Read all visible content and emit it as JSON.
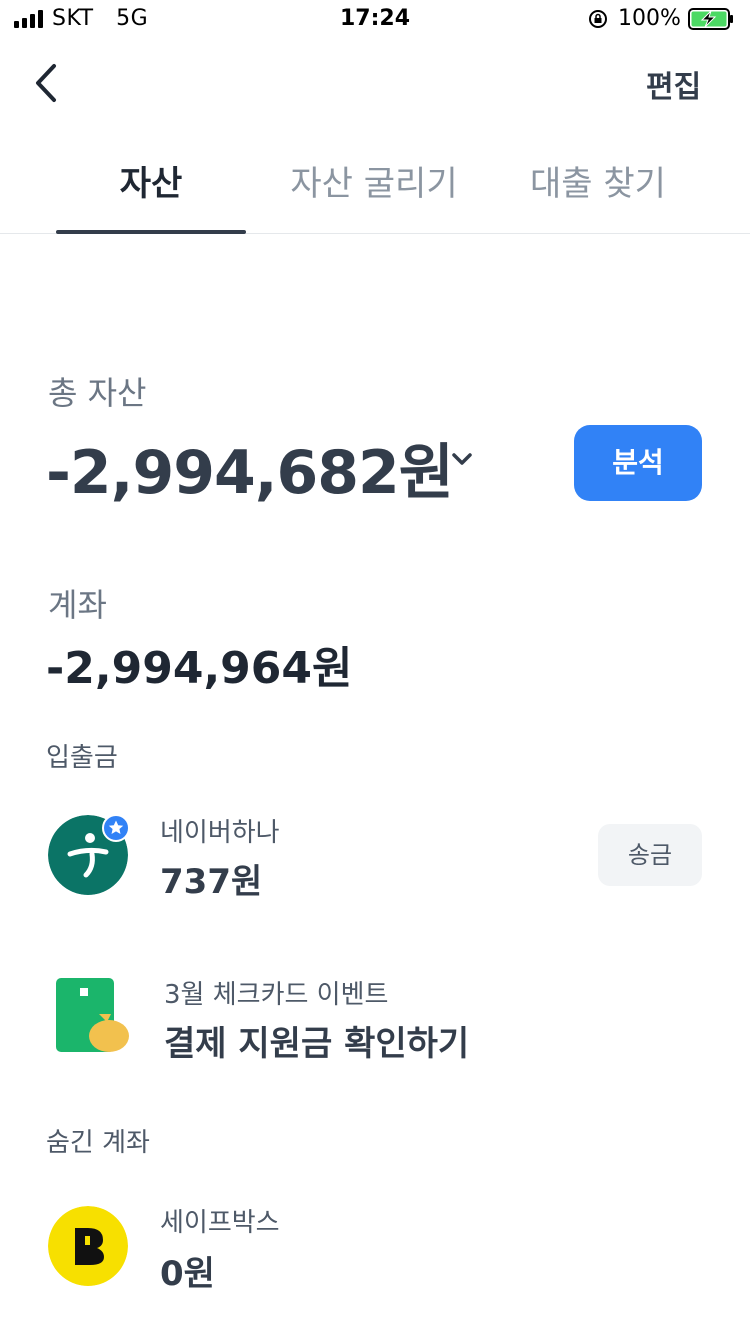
{
  "status_bar": {
    "carrier": "SKT",
    "network": "5G",
    "time": "17:24",
    "battery": "100%"
  },
  "header": {
    "edit_label": "편집"
  },
  "tabs": [
    {
      "label": "자산"
    },
    {
      "label": "자산 굴리기"
    },
    {
      "label": "대출 찾기"
    }
  ],
  "total": {
    "label": "총 자산",
    "amount": "-2,994,682원",
    "analysis_label": "분석"
  },
  "accounts": {
    "label": "계좌",
    "amount": "-2,994,964원"
  },
  "deposit_section": {
    "title": "입출금",
    "items": [
      {
        "name": "네이버하나",
        "amount": "737원",
        "action": "송금"
      }
    ]
  },
  "promo": {
    "subtitle": "3월 체크카드 이벤트",
    "title": "결제 지원금 확인하기"
  },
  "hidden_section": {
    "title": "숨긴 계좌",
    "items": [
      {
        "name": "세이프박스",
        "amount": "0원"
      }
    ]
  },
  "colors": {
    "accent": "#3182f6",
    "hana_green": "#0b7466",
    "kbank_yellow": "#f7e000",
    "promo_green": "#1bb56b",
    "promo_gold": "#f2c14e"
  }
}
